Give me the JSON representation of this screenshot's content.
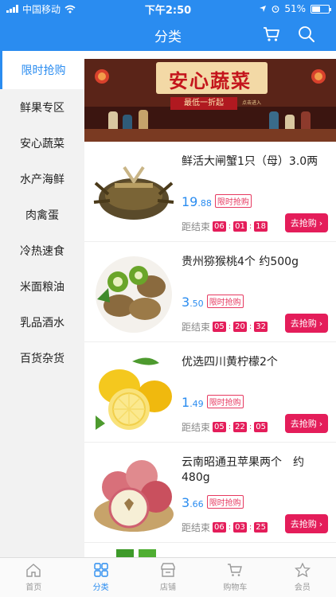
{
  "status_bar": {
    "carrier": "中国移动",
    "time": "下午2:50",
    "battery": "51%",
    "battery_level": 0.51
  },
  "header": {
    "title": "分类",
    "cart_icon": "cart-icon",
    "search_icon": "search-icon"
  },
  "sidebar": {
    "items": [
      {
        "label": "限时抢购",
        "active": true
      },
      {
        "label": "鲜果专区"
      },
      {
        "label": "安心蔬菜"
      },
      {
        "label": "水产海鲜"
      },
      {
        "label": "肉禽蛋"
      },
      {
        "label": "冷热速食"
      },
      {
        "label": "米面粮油"
      },
      {
        "label": "乳品酒水"
      },
      {
        "label": "百货杂货"
      }
    ]
  },
  "banner": {
    "title": "安心蔬菜",
    "subtitle": "最低一折起",
    "small_text": "点击进入"
  },
  "products": [
    {
      "name": "鲜活大闸蟹1只（母）3.0两",
      "price_int": "19",
      "price_dec": ".88",
      "tag": "限时抢购",
      "countdown_label": "距结束",
      "h": "06",
      "m": "01",
      "s": "18",
      "buy_label": "去抢购"
    },
    {
      "name": "贵州猕猴桃4个 约500g",
      "price_int": "3",
      "price_dec": ".50",
      "tag": "限时抢购",
      "countdown_label": "距结束",
      "h": "05",
      "m": "20",
      "s": "32",
      "buy_label": "去抢购"
    },
    {
      "name": "优选四川黄柠檬2个",
      "price_int": "1",
      "price_dec": ".49",
      "tag": "限时抢购",
      "countdown_label": "距结束",
      "h": "05",
      "m": "22",
      "s": "05",
      "buy_label": "去抢购"
    },
    {
      "name": "云南昭通丑苹果两个　约480g",
      "price_int": "3",
      "price_dec": ".66",
      "tag": "限时抢购",
      "countdown_label": "距结束",
      "h": "06",
      "m": "03",
      "s": "25",
      "buy_label": "去抢购"
    }
  ],
  "tabbar": [
    {
      "label": "首页",
      "icon": "home-icon"
    },
    {
      "label": "分类",
      "icon": "category-icon",
      "active": true
    },
    {
      "label": "店铺",
      "icon": "shop-icon"
    },
    {
      "label": "购物车",
      "icon": "cart-icon"
    },
    {
      "label": "会员",
      "icon": "star-icon"
    }
  ],
  "colors": {
    "primary": "#2a8cf0",
    "accent": "#e41d5a",
    "sidebar_bg": "#f2f2f2"
  }
}
